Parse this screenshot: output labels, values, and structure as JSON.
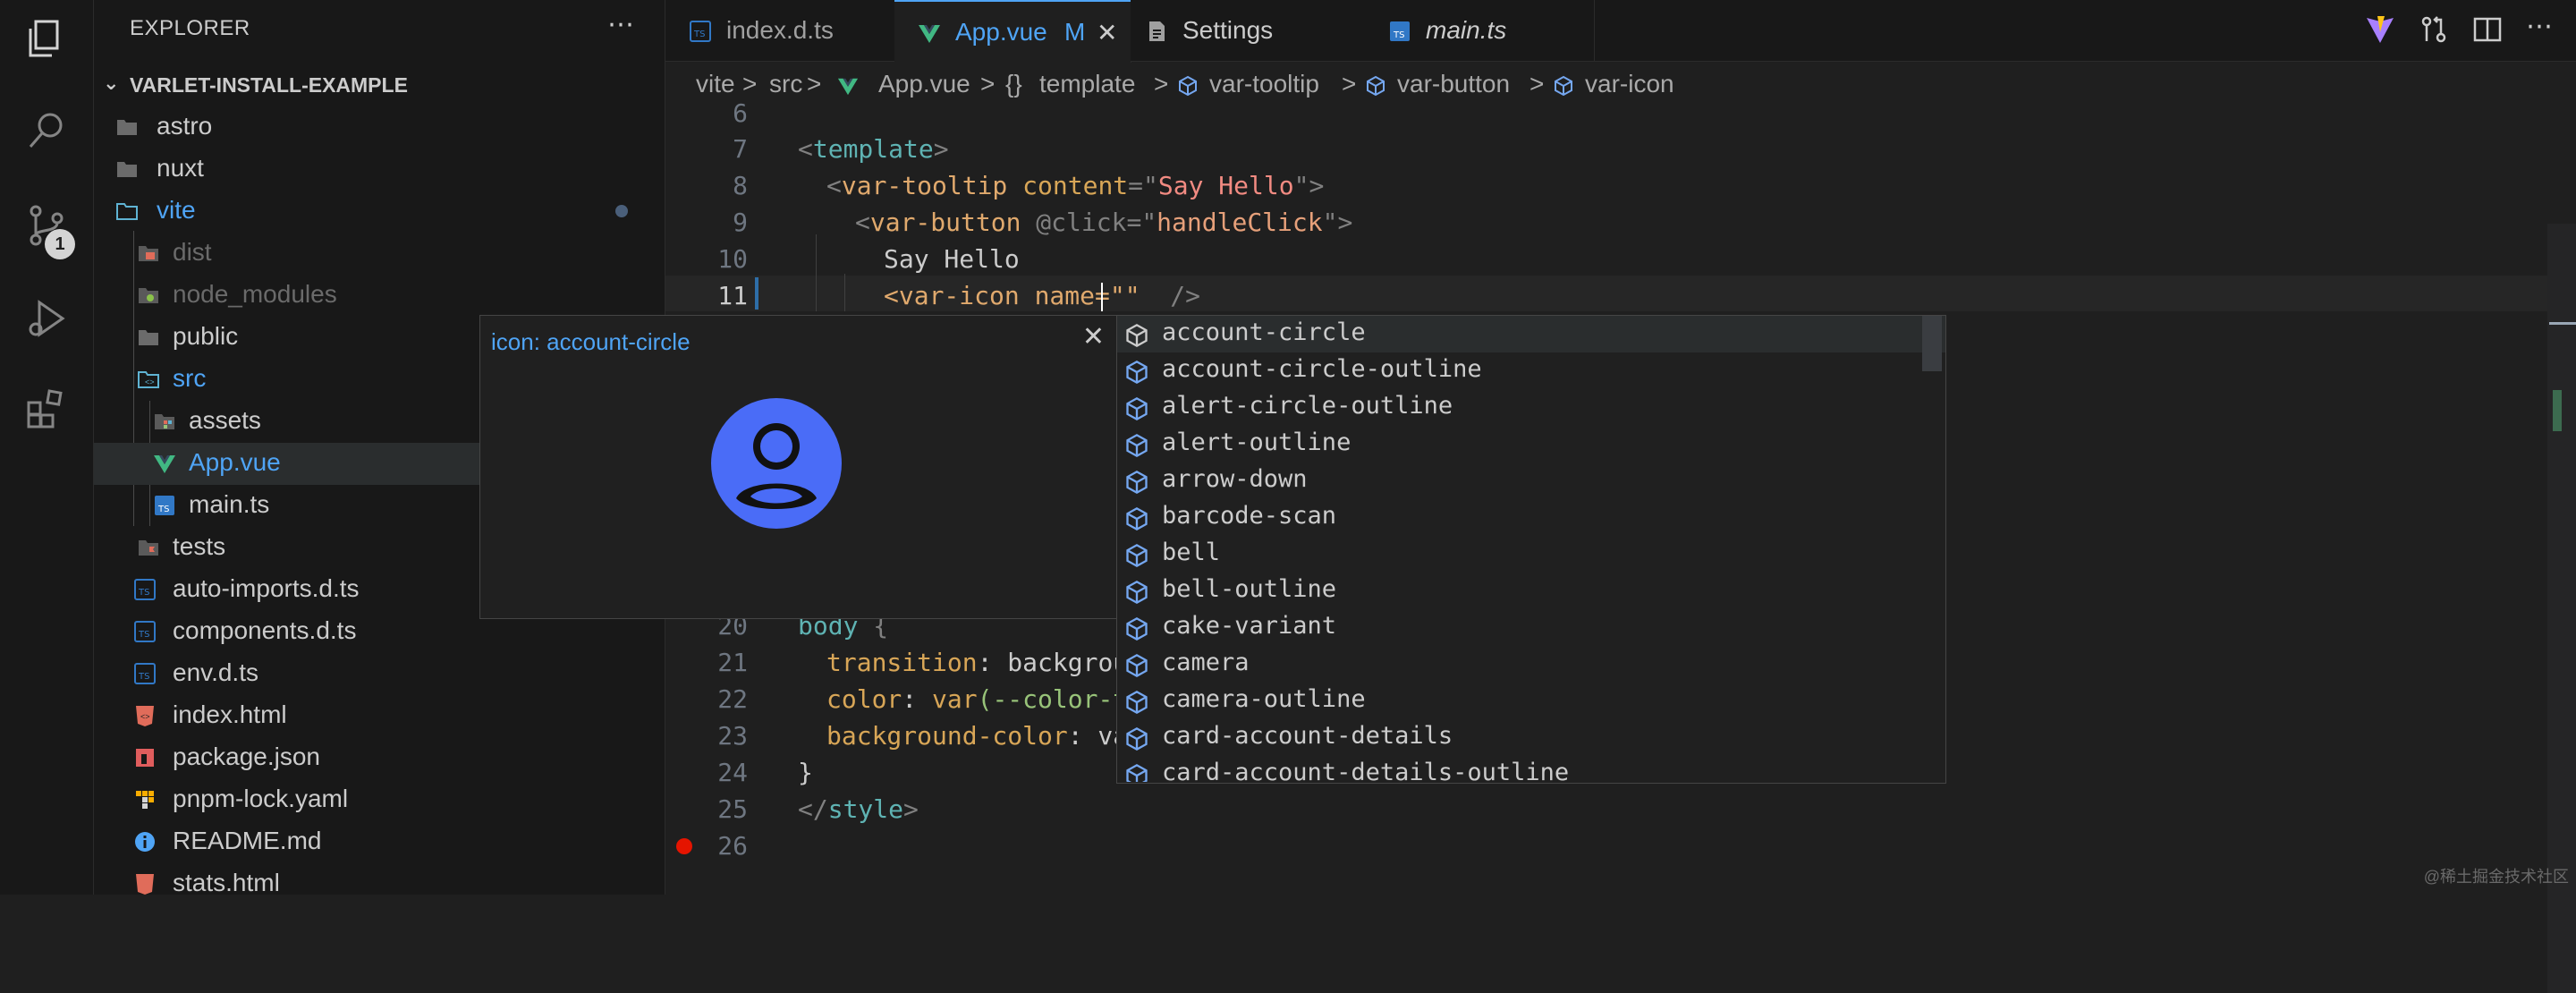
{
  "explorer": {
    "title": "EXPLORER",
    "more": "⋯",
    "project": "VARLET-INSTALL-EXAMPLE",
    "items": [
      {
        "label": "astro",
        "icon": "folder-icon"
      },
      {
        "label": "nuxt",
        "icon": "folder-icon"
      },
      {
        "label": "vite",
        "icon": "folder-open-icon"
      },
      {
        "label": "dist",
        "icon": "folder-dist-icon"
      },
      {
        "label": "node_modules",
        "icon": "folder-node-icon"
      },
      {
        "label": "public",
        "icon": "folder-icon"
      },
      {
        "label": "src",
        "icon": "folder-src-icon"
      },
      {
        "label": "assets",
        "icon": "folder-assets-icon"
      },
      {
        "label": "App.vue",
        "icon": "vue-icon"
      },
      {
        "label": "main.ts",
        "icon": "typescript-icon"
      },
      {
        "label": "tests",
        "icon": "folder-tests-icon"
      },
      {
        "label": "auto-imports.d.ts",
        "icon": "typescript-icon"
      },
      {
        "label": "components.d.ts",
        "icon": "typescript-icon"
      },
      {
        "label": "env.d.ts",
        "icon": "typescript-icon"
      },
      {
        "label": "index.html",
        "icon": "html-icon"
      },
      {
        "label": "package.json",
        "icon": "npm-icon"
      },
      {
        "label": "pnpm-lock.yaml",
        "icon": "pnpm-icon"
      },
      {
        "label": "README.md",
        "icon": "info-icon"
      },
      {
        "label": "stats.html",
        "icon": "html-icon"
      }
    ]
  },
  "activity": {
    "scm_badge": "1"
  },
  "tabs": [
    {
      "label": "index.d.ts",
      "icon": "typescript-icon"
    },
    {
      "label": "App.vue",
      "icon": "vue-icon",
      "status": "M",
      "close": "✕"
    },
    {
      "label": "Settings",
      "icon": "settings-file-icon"
    },
    {
      "label": "main.ts",
      "icon": "typescript-icon"
    }
  ],
  "breadcrumb": {
    "items": [
      "vite",
      "src",
      "App.vue",
      "template",
      "var-tooltip",
      "var-button",
      "var-icon"
    ],
    "braces": "{}",
    "sep": ">"
  },
  "editor": {
    "line_numbers": [
      "6",
      "7",
      "8",
      "9",
      "10",
      "11",
      "20",
      "21",
      "22",
      "23",
      "24",
      "25",
      "26"
    ],
    "lines": {
      "l7": [
        "<",
        "template",
        ">"
      ],
      "l8": [
        "<",
        "var-tooltip",
        " content",
        "=",
        "\"",
        "Say Hello",
        "\"",
        ">"
      ],
      "l9": [
        "<",
        "var-button",
        " @click",
        "=",
        "\"",
        "handleClick",
        "\"",
        ">"
      ],
      "l10": "Say Hello",
      "l11": [
        "<var-icon name=\"\"",
        "  />"
      ],
      "l20": [
        "body",
        " {"
      ],
      "l21": [
        "transition",
        ": backgrou"
      ],
      "l22": [
        "color",
        ": ",
        "var",
        "(--color-t"
      ],
      "l23": [
        "background-color",
        ": va"
      ],
      "l24": "}",
      "l25": [
        "</",
        "style",
        ">"
      ]
    }
  },
  "hover": {
    "title": "icon: account-circle",
    "close": "✕",
    "icon_color": "#4a6cf7"
  },
  "suggestions": [
    "account-circle",
    "account-circle-outline",
    "alert-circle-outline",
    "alert-outline",
    "arrow-down",
    "barcode-scan",
    "bell",
    "bell-outline",
    "cake-variant",
    "camera",
    "camera-outline",
    "card-account-details",
    "card-account-details-outline"
  ],
  "watermark": "@稀土掘金技术社区",
  "colors": {
    "accent": "#4fa4f5",
    "vue": "#41b883",
    "typescript": "#3178c6"
  }
}
